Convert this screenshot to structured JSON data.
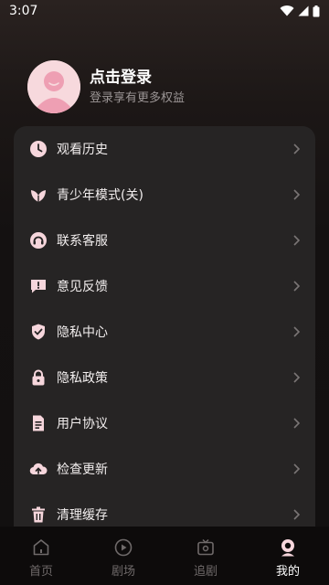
{
  "status_bar": {
    "time": "3:07"
  },
  "profile": {
    "title": "点击登录",
    "subtitle": "登录享有更多权益"
  },
  "menu": {
    "items": [
      {
        "label": "观看历史",
        "icon": "history-clock-icon"
      },
      {
        "label": "青少年模式(关)",
        "icon": "leaf-icon"
      },
      {
        "label": "联系客服",
        "icon": "headset-icon"
      },
      {
        "label": "意见反馈",
        "icon": "feedback-icon"
      },
      {
        "label": "隐私中心",
        "icon": "shield-check-icon"
      },
      {
        "label": "隐私政策",
        "icon": "lock-icon"
      },
      {
        "label": "用户协议",
        "icon": "document-icon"
      },
      {
        "label": "检查更新",
        "icon": "cloud-upload-icon"
      },
      {
        "label": "清理缓存",
        "icon": "trash-icon"
      }
    ]
  },
  "tabs": [
    {
      "label": "首页",
      "icon": "home-icon",
      "active": false
    },
    {
      "label": "剧场",
      "icon": "play-circle-icon",
      "active": false
    },
    {
      "label": "追剧",
      "icon": "tv-icon",
      "active": false
    },
    {
      "label": "我的",
      "icon": "profile-icon",
      "active": true
    }
  ],
  "colors": {
    "background": "#141111",
    "card": "#262424",
    "icon_tint": "#f6d6dc",
    "text_primary": "#ffffff",
    "text_secondary": "#9a9494",
    "tab_inactive": "#6f6a6a"
  }
}
